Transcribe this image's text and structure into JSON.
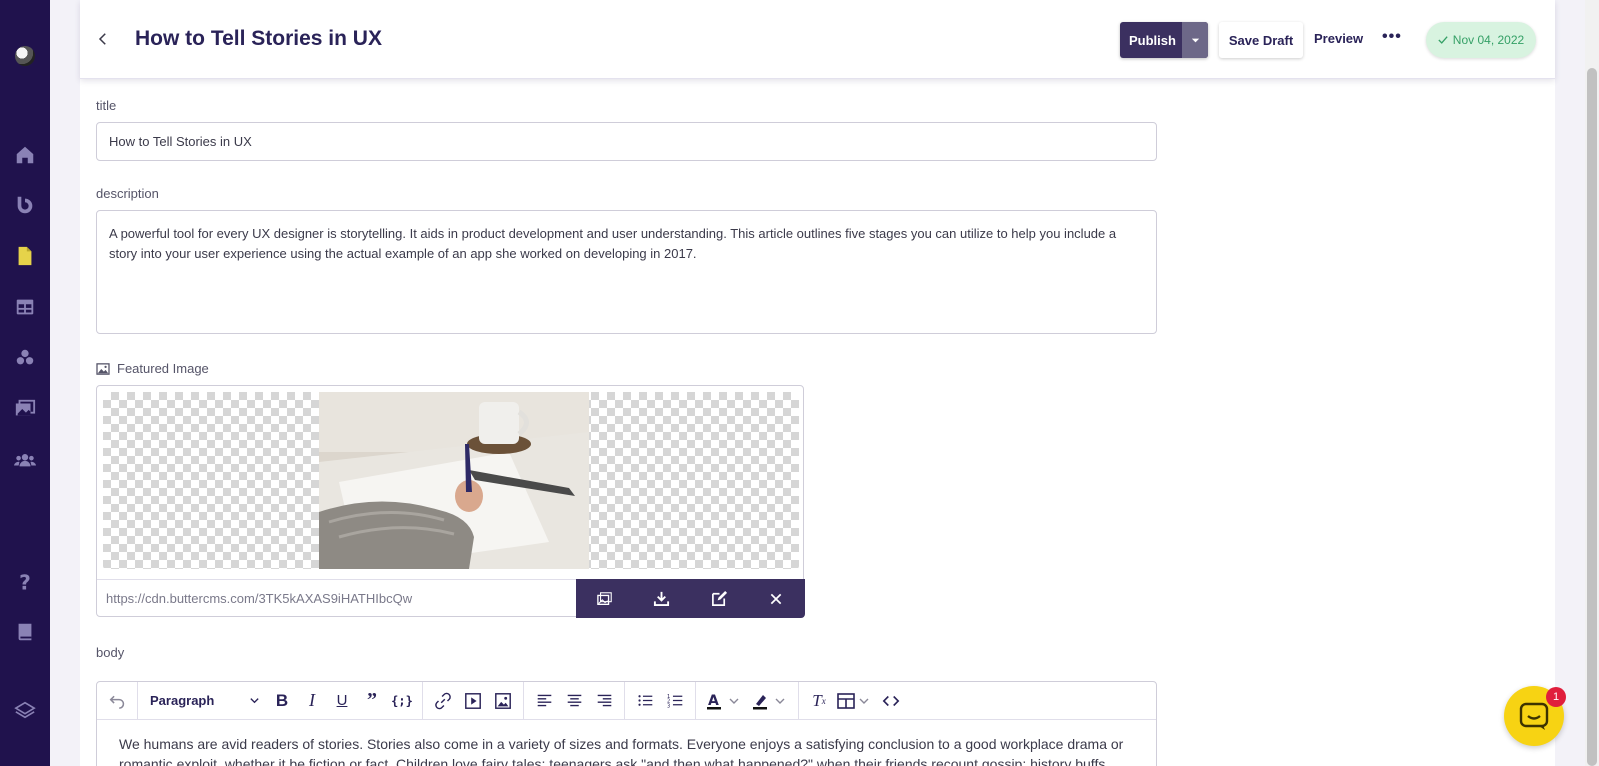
{
  "header": {
    "title": "How to Tell Stories in UX",
    "publish_label": "Publish",
    "save_draft_label": "Save Draft",
    "preview_label": "Preview",
    "more_label": "•••",
    "date": "Nov 04, 2022"
  },
  "form": {
    "title_label": "title",
    "title_value": "How to Tell Stories in UX",
    "description_label": "description",
    "description_value": "A powerful tool for every UX designer is storytelling. It aids in product development and user understanding. This article outlines five stages you can utilize to help you include a story into your user experience using the actual example of an app she worked on developing in 2017.",
    "featured_image_label": "Featured Image",
    "featured_image_url": "https://cdn.buttercms.com/3TK5kAXAS9iHATHIbcQw",
    "body_label": "body"
  },
  "editor": {
    "paragraph_label": "Paragraph",
    "body_text": "We humans are avid readers of stories. Stories also come in a variety of sizes and formats. Everyone enjoys a satisfying conclusion to a good workplace drama or romantic exploit, whether it be fiction or fact. Children love fairy tales; teenagers ask \"and then what happened?\" when their friends recount gossip; history buffs"
  },
  "chat": {
    "badge_count": "1"
  },
  "colors": {
    "sidebar": "#20124d",
    "accent": "#3b3060",
    "badge_green": "#d8f3e0",
    "chat_yellow": "#f7d313"
  }
}
